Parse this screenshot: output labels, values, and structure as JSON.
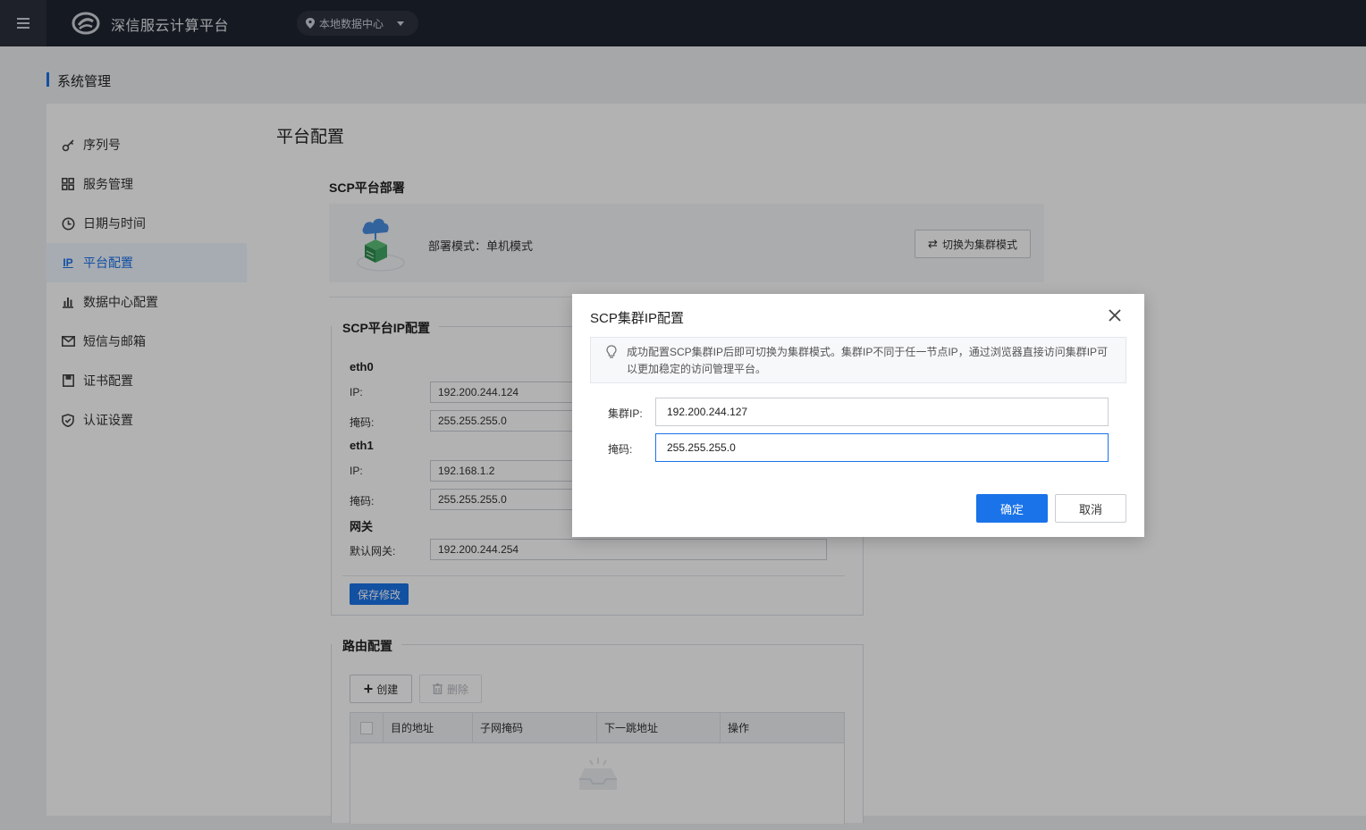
{
  "app": {
    "title": "深信服云计算平台",
    "datacenter": "本地数据中心"
  },
  "breadcrumb": "系统管理",
  "sidebar": {
    "items": [
      {
        "label": "序列号",
        "icon": "key-icon"
      },
      {
        "label": "服务管理",
        "icon": "grid-icon"
      },
      {
        "label": "日期与时间",
        "icon": "clock-icon"
      },
      {
        "label": "平台配置",
        "icon": "ip-icon",
        "active": true
      },
      {
        "label": "数据中心配置",
        "icon": "bar-chart-icon"
      },
      {
        "label": "短信与邮箱",
        "icon": "mail-icon"
      },
      {
        "label": "证书配置",
        "icon": "certificate-icon"
      },
      {
        "label": "认证设置",
        "icon": "shield-icon"
      }
    ]
  },
  "main": {
    "title": "平台配置",
    "deploy": {
      "section_title": "SCP平台部署",
      "mode_text": "部署模式：单机模式",
      "switch_label": "切换为集群模式"
    },
    "ip_config": {
      "legend": "SCP平台IP配置",
      "eth0": {
        "name": "eth0",
        "ip_label": "IP:",
        "ip": "192.200.244.124",
        "mask_label": "掩码:",
        "mask": "255.255.255.0"
      },
      "eth1": {
        "name": "eth1",
        "ip_label": "IP:",
        "ip": "192.168.1.2",
        "mask_label": "掩码:",
        "mask": "255.255.255.0"
      },
      "gateway": {
        "name": "网关",
        "label": "默认网关:",
        "value": "192.200.244.254"
      },
      "save_label": "保存修改"
    },
    "route": {
      "legend": "路由配置",
      "create_label": "创建",
      "delete_label": "删除",
      "columns": [
        "目的地址",
        "子网掩码",
        "下一跳地址",
        "操作"
      ]
    }
  },
  "modal": {
    "title": "SCP集群IP配置",
    "notice": "成功配置SCP集群IP后即可切换为集群模式。集群IP不同于任一节点IP，通过浏览器直接访问集群IP可以更加稳定的访问管理平台。",
    "cluster_ip_label": "集群IP:",
    "cluster_ip": "192.200.244.127",
    "mask_label": "掩码:",
    "mask": "255.255.255.0",
    "ok_label": "确定",
    "cancel_label": "取消"
  },
  "colors": {
    "accent": "#1a73e8",
    "topbar": "#1f2430"
  }
}
